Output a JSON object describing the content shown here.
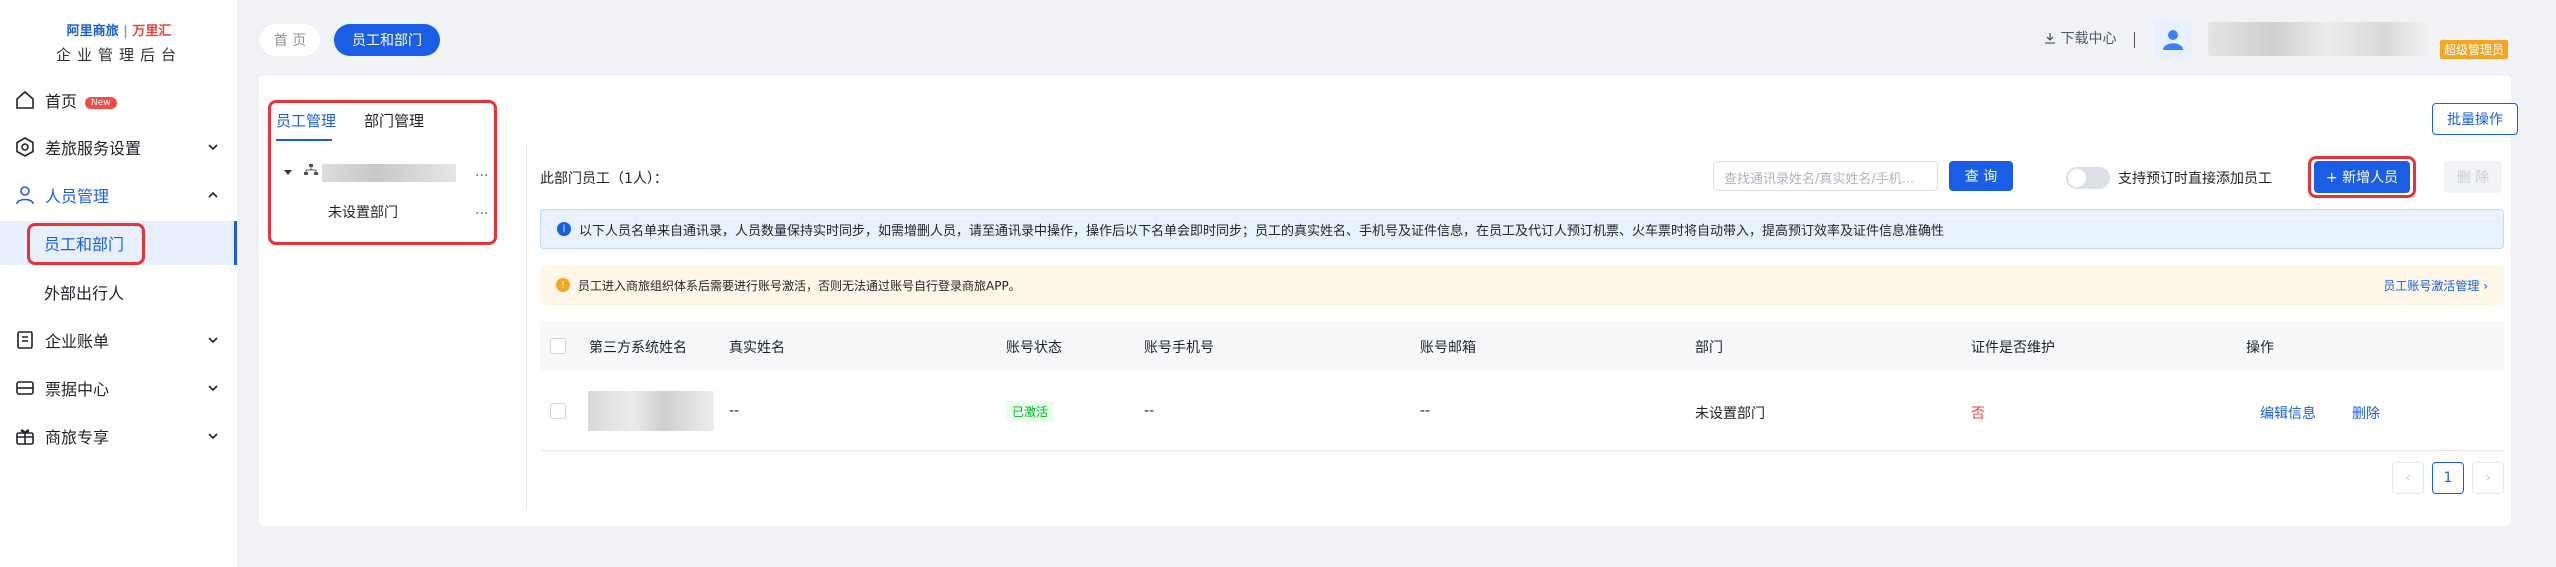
{
  "logo": {
    "brand": "阿里商旅",
    "partner": "万里汇",
    "subtitle": "企业管理后台"
  },
  "sidebar": {
    "items": [
      {
        "label": "首页",
        "badge": "New"
      },
      {
        "label": "差旅服务设置"
      },
      {
        "label": "人员管理"
      },
      {
        "label": "员工和部门"
      },
      {
        "label": "外部出行人"
      },
      {
        "label": "企业账单"
      },
      {
        "label": "票据中心"
      },
      {
        "label": "商旅专享"
      }
    ]
  },
  "header": {
    "tabs": [
      "首 页",
      "员工和部门"
    ],
    "download": "下载中心",
    "role": "超级管理员"
  },
  "left_panel": {
    "tabs": [
      "员工管理",
      "部门管理"
    ],
    "tree": {
      "unset": "未设置部门",
      "more": "..."
    }
  },
  "toolbar": {
    "batch": "批量操作",
    "dept_count": "此部门员工（1人）：",
    "search_placeholder": "查找通讯录姓名/真实姓名/手机...",
    "search_btn": "查 询",
    "toggle_label": "支持预订时直接添加员工",
    "add_btn": "+ 新增人员",
    "delete_btn": "删 除"
  },
  "notices": {
    "info": "以下人员名单来自通讯录，人员数量保持实时同步，如需增删人员，请至通讯录中操作，操作后以下名单会即时同步；员工的真实姓名、手机号及证件信息，在员工及代订人预订机票、火车票时将自动带入，提高预订效率及证件信息准确性",
    "warn": "员工进入商旅组织体系后需要进行账号激活，否则无法通过账号自行登录商旅APP。",
    "warn_link": "员工账号激活管理 ›"
  },
  "table": {
    "headers": [
      "第三方系统姓名",
      "真实姓名",
      "账号状态",
      "账号手机号",
      "账号邮箱",
      "部门",
      "证件是否维护",
      "操作"
    ],
    "rows": [
      {
        "real_name": "--",
        "status": "已激活",
        "phone": "--",
        "email": "--",
        "dept": "未设置部门",
        "cert": "否",
        "edit": "编辑信息",
        "delete": "删除"
      }
    ]
  },
  "pagination": {
    "prev": "‹",
    "current": "1",
    "next": "›"
  },
  "colors": {
    "primary": "#1b5ee6",
    "highlight": "#e8333a",
    "active_status": "#00b42a",
    "danger": "#f53f3f"
  }
}
